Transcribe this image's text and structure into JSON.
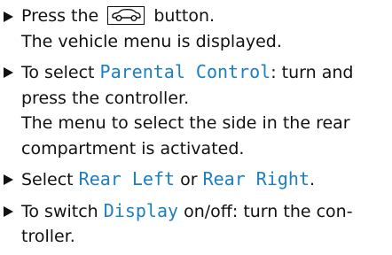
{
  "steps": [
    {
      "before": "Press the",
      "icon": "vehicle-car-icon",
      "after": "button.",
      "result": "The vehicle menu is displayed."
    },
    {
      "before": "To select",
      "keyword": "Parental Control",
      "after": ": turn and press the controller.",
      "result": "The menu to select the side in the rear compartment is activated."
    },
    {
      "before": "Select",
      "keyword1": "Rear Left",
      "middle": "or",
      "keyword2": "Rear Right",
      "after": "."
    },
    {
      "before": "To switch",
      "keyword": "Display",
      "after": "on/off: turn the con-troller."
    }
  ],
  "colors": {
    "keyword": "#1a7fc4",
    "text": "#111111"
  }
}
